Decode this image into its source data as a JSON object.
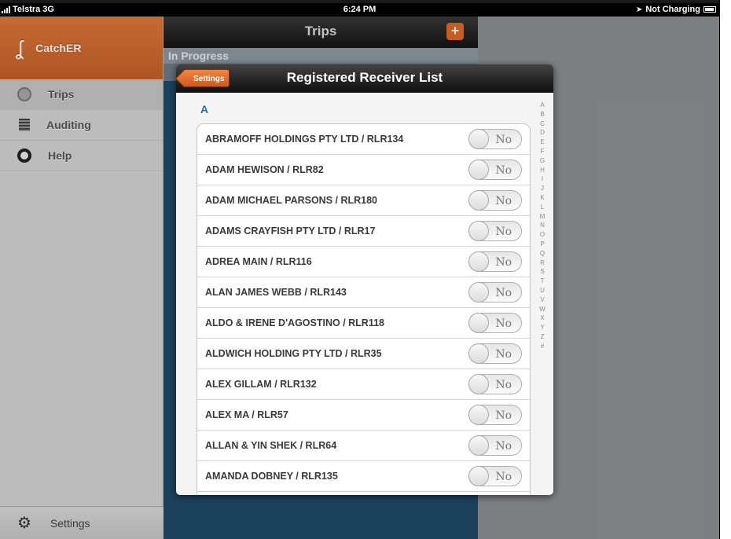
{
  "status_bar": {
    "carrier": "Telstra",
    "network": "3G",
    "time": "6:24 PM",
    "charging": "Not Charging"
  },
  "sidebar": {
    "app_name": "CatchER",
    "items": [
      {
        "label": "Trips",
        "icon": "globe-icon",
        "active": true
      },
      {
        "label": "Auditing",
        "icon": "document-icon",
        "active": false
      },
      {
        "label": "Help",
        "icon": "lifebuoy-icon",
        "active": false
      }
    ],
    "settings_label": "Settings"
  },
  "trips_pane": {
    "title": "Trips",
    "add_symbol": "+",
    "section": "In Progress"
  },
  "modal": {
    "title": "Registered Receiver List",
    "back_label": "Settings",
    "section_header": "A",
    "rows": [
      {
        "name": "ABRAMOFF HOLDINGS PTY LTD / RLR134",
        "toggle": "No"
      },
      {
        "name": "ADAM HEWISON / RLR82",
        "toggle": "No"
      },
      {
        "name": "ADAM MICHAEL PARSONS / RLR180",
        "toggle": "No"
      },
      {
        "name": "ADAMS CRAYFISH PTY LTD / RLR17",
        "toggle": "No"
      },
      {
        "name": "ADREA MAIN / RLR116",
        "toggle": "No"
      },
      {
        "name": "ALAN JAMES WEBB / RLR143",
        "toggle": "No"
      },
      {
        "name": "ALDO & IRENE D'AGOSTINO / RLR118",
        "toggle": "No"
      },
      {
        "name": "ALDWICH HOLDING PTY LTD / RLR35",
        "toggle": "No"
      },
      {
        "name": "ALEX GILLAM / RLR132",
        "toggle": "No"
      },
      {
        "name": "ALEX MA / RLR57",
        "toggle": "No"
      },
      {
        "name": "ALLAN & YIN SHEK / RLR64",
        "toggle": "No"
      },
      {
        "name": "AMANDA DOBNEY / RLR135",
        "toggle": "No"
      }
    ],
    "index": [
      "A",
      "B",
      "C",
      "D",
      "E",
      "F",
      "G",
      "H",
      "I",
      "J",
      "K",
      "L",
      "M",
      "N",
      "O",
      "P",
      "Q",
      "R",
      "S",
      "T",
      "U",
      "V",
      "W",
      "X",
      "Y",
      "Z",
      "#"
    ]
  }
}
